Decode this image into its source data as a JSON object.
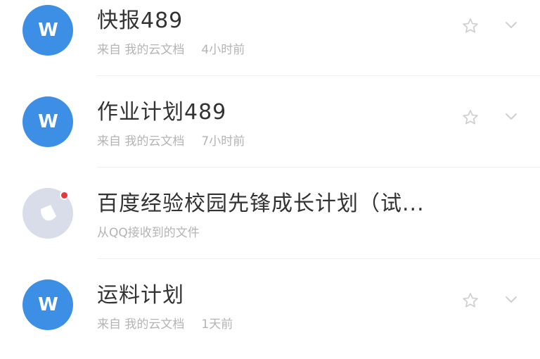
{
  "files": [
    {
      "title": "快报489",
      "source": "来自 我的云文档",
      "time": "4小时前",
      "icon": "wps-doc-icon",
      "icon_color": "#3d8fe6",
      "icon_letter": "W",
      "has_star": true
    },
    {
      "title": "作业计划489",
      "source": "来自 我的云文档",
      "time": "7小时前",
      "icon": "wps-doc-icon",
      "icon_color": "#3d8fe6",
      "icon_letter": "W",
      "has_star": true
    },
    {
      "title": "百度经验校园先锋成长计划（试...",
      "source": "从QQ接收到的文件",
      "time": "",
      "icon": "qq-file-icon",
      "icon_color": "#d9dde9",
      "has_star": false
    },
    {
      "title": "运料计划",
      "source": "来自 我的云文档",
      "time": "1天前",
      "icon": "wps-doc-icon",
      "icon_color": "#3d8fe6",
      "icon_letter": "W",
      "has_star": true
    }
  ]
}
